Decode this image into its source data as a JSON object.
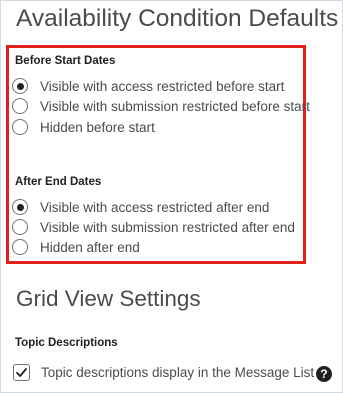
{
  "page": {
    "title": "Availability Condition Defaults"
  },
  "before_start": {
    "label": "Before Start Dates",
    "options": [
      {
        "label": "Visible with access restricted before start",
        "selected": true
      },
      {
        "label": "Visible with submission restricted before start",
        "selected": false
      },
      {
        "label": "Hidden before start",
        "selected": false
      }
    ]
  },
  "after_end": {
    "label": "After End Dates",
    "options": [
      {
        "label": "Visible with access restricted after end",
        "selected": true
      },
      {
        "label": "Visible with submission restricted after end",
        "selected": false
      },
      {
        "label": "Hidden after end",
        "selected": false
      }
    ]
  },
  "grid_view": {
    "title": "Grid View Settings",
    "topic_descriptions": {
      "label": "Topic Descriptions",
      "checkbox_label": "Topic descriptions display in the Message List",
      "checked": true,
      "help_icon": "question-circle-icon"
    }
  },
  "colors": {
    "highlight_border": "#e0201b",
    "text": "#494c4e"
  }
}
